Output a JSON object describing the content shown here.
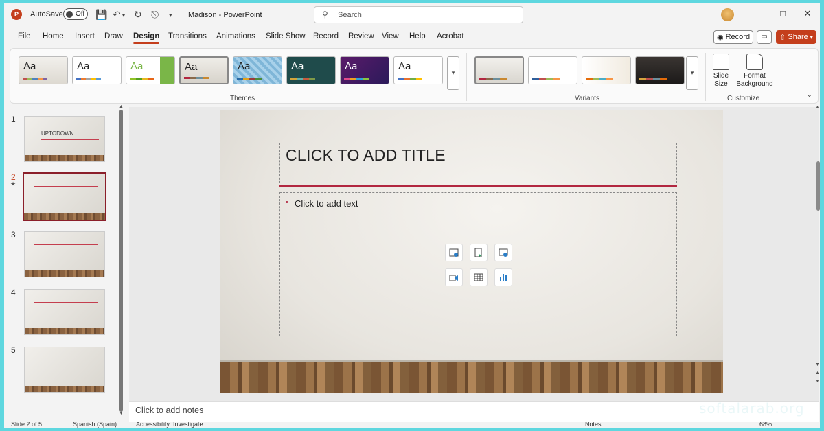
{
  "titlebar": {
    "autosave_label": "AutoSave",
    "autosave_state": "Off",
    "window_title": "Madison  -  PowerPoint",
    "search_placeholder": "Search",
    "logo_letter": "P"
  },
  "tabs": [
    "File",
    "Home",
    "Insert",
    "Draw",
    "Design",
    "Transitions",
    "Animations",
    "Slide Show",
    "Record",
    "Review",
    "View",
    "Help",
    "Acrobat"
  ],
  "active_tab": "Design",
  "actions": {
    "record": "Record",
    "share": "Share"
  },
  "ribbon": {
    "themes_label": "Themes",
    "variants_label": "Variants",
    "customize_label": "Customize",
    "slide_size": "Slide\nSize",
    "format_background": "Format\nBackground",
    "theme_aa": "Aa"
  },
  "slides": [
    {
      "num": "1",
      "thumb_text": "UPTODOWN"
    },
    {
      "num": "2",
      "thumb_text": ""
    },
    {
      "num": "3",
      "thumb_text": ""
    },
    {
      "num": "4",
      "thumb_text": ""
    },
    {
      "num": "5",
      "thumb_text": ""
    }
  ],
  "current_slide": 2,
  "slide": {
    "title": "CLICK TO ADD TITLE",
    "content": "Click to add text"
  },
  "notes_placeholder": "Click to add notes",
  "status": {
    "slide_info": "Slide 2 of 5",
    "language": "Spanish (Spain)",
    "accessibility": "Accessibility: Investigate",
    "notes": "Notes",
    "zoom": "68%"
  },
  "watermark": "softalarab.org",
  "colors": {
    "accent": "#c43e1c",
    "title_rule": "#b22740"
  }
}
